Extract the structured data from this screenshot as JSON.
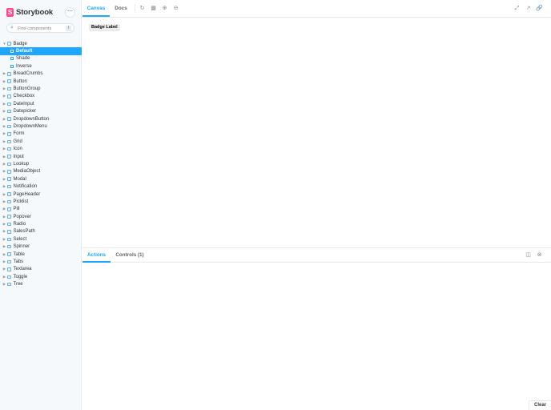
{
  "brand": {
    "name": "Storybook",
    "logo_letter": "S"
  },
  "menu_glyph": "⋯",
  "search": {
    "placeholder": "Find components",
    "shortcut": "/"
  },
  "tree": {
    "badge": {
      "label": "Badge",
      "stories": [
        "Default",
        "Shade",
        "Inverse"
      ],
      "selected": "Default"
    },
    "components": [
      "BreadCrumbs",
      "Button",
      "ButtonGroup",
      "Checkbox",
      "DateInput",
      "Datepicker",
      "DropdownButton",
      "DropdownMenu",
      "Form",
      "Grid",
      "Icon",
      "Input",
      "Lookup",
      "MediaObject",
      "Modal",
      "Notification",
      "PageHeader",
      "Picklist",
      "Pill",
      "Popover",
      "Radio",
      "SalesPath",
      "Select",
      "Spinner",
      "Table",
      "Tabs",
      "Textarea",
      "Toggle",
      "Tree"
    ]
  },
  "toolbar": {
    "tabs": {
      "canvas": "Canvas",
      "docs": "Docs"
    },
    "icons": [
      "reload-icon",
      "grid-icon",
      "zoom-icon",
      "reset-zoom-icon",
      "fullscreen-icon",
      "open-new-tab-icon",
      "copy-link-icon"
    ]
  },
  "canvas": {
    "badge_label": "Badge Label"
  },
  "panel": {
    "tabs": {
      "actions": "Actions",
      "controls": "Controls (1)"
    },
    "clear": "Clear"
  },
  "colors": {
    "accent": "#1ea7fd",
    "brand": "#ff4785",
    "sidebar_bg": "#f6f9fc"
  }
}
